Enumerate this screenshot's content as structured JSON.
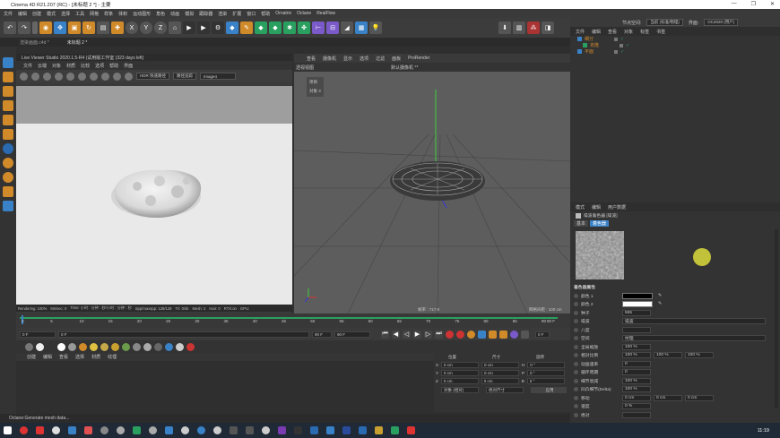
{
  "window": {
    "title": "Cinema 4D R21.207 (RC) - [未标题 2 *] - 主要",
    "controls": [
      "—",
      "❐",
      "✕"
    ]
  },
  "menubar": [
    "文件",
    "编辑",
    "创建",
    "模式",
    "选择",
    "工具",
    "网格",
    "样条",
    "体积",
    "运动图形",
    "角色",
    "动画",
    "模拟",
    "跟踪器",
    "渲染",
    "扩展",
    "窗口",
    "帮助",
    "Ornatrix",
    "Octane",
    "RealFlow"
  ],
  "doc_tabs": [
    "渲染画面.c4d *",
    "未标题 2 *"
  ],
  "live_viewer": {
    "header": "Live Viewer Studio 2020.1.5-R4 (试用版工作室 (323 days left)",
    "menu": [
      "文件",
      "云端",
      "对象",
      "材质",
      "比较",
      "选项",
      "帮助",
      "界面"
    ],
    "hdr_select": "HDR 快速路径",
    "mode_select": "路径追踪",
    "image_select": "Image4",
    "status": [
      "Rendering: 100%",
      "Ms/sec: 0",
      "Time: 小时 : 分钟 : 秒/小时 : 分钟 : 秒",
      "Spp/maxspp: 128/128",
      "Tri: 0/4k",
      "Mesh: 2",
      "Hair: 0",
      "RTX:on",
      "GPU:"
    ]
  },
  "viewport": {
    "menu": [
      "查看",
      "摄像机",
      "显示",
      "选项",
      "过滤",
      "面板",
      "ProRender"
    ],
    "label": "透视视图",
    "camera": "默认摄像机 °*",
    "hud": [
      "项目",
      "对象  3"
    ],
    "grid_info": "网格间距 : 100 cm",
    "frame_info": "帧率 : 717.9"
  },
  "timeline": {
    "ticks": [
      "0",
      "5",
      "10",
      "15",
      "20",
      "25",
      "30",
      "35",
      "40",
      "45",
      "50",
      "55",
      "60",
      "65",
      "70",
      "75",
      "80",
      "85",
      "90"
    ],
    "end_frame": "90 F",
    "current": "0 F",
    "start": "0 F",
    "field_start": "0 F",
    "field_end": "90 F",
    "field_end2": "90 F",
    "frame_right": "0 F"
  },
  "materials_menu": [
    "创建",
    "编辑",
    "查看",
    "选择",
    "材质",
    "纹理"
  ],
  "coords": {
    "headers": [
      "位置",
      "尺寸",
      "旋转"
    ],
    "rows": [
      {
        "axis": "X",
        "pos": "0 cm",
        "size": "0 cm",
        "rot_label": "H",
        "rot": "0 °"
      },
      {
        "axis": "Y",
        "pos": "0 cm",
        "size": "0 cm",
        "rot_label": "P",
        "rot": "0 °"
      },
      {
        "axis": "Z",
        "pos": "0 cm",
        "size": "0 cm",
        "rot_label": "B",
        "rot": "0 °"
      }
    ],
    "mode_select": "对象 (相对)",
    "size_select": "绝对尺寸",
    "apply": "应用"
  },
  "status_text": "Octane:Generate mesh data...",
  "right_panel": {
    "node_space_label": "节点空间:",
    "node_space": "当前 (标准/物理)",
    "layout_label": "界面:",
    "layout": "OC2020 (用户)",
    "obj_menu": [
      "文件",
      "编辑",
      "查看",
      "对象",
      "标签",
      "书签"
    ],
    "objects": [
      "细分",
      "克隆",
      "平面"
    ],
    "attr_menu": [
      "模式",
      "编辑",
      "用户数据"
    ],
    "shader_title": "噪波着色器 [噪波]",
    "tabs": [
      "基本",
      "着色器"
    ],
    "section": "着色器属性",
    "color1_label": "颜色 1",
    "color1": "#000000",
    "color2_label": "颜色 2",
    "color2": "#ffffff",
    "rows": [
      {
        "label": "种子",
        "values": [
          "665"
        ]
      },
      {
        "label": "噪波",
        "values": [
          "噪波"
        ]
      },
      {
        "label": "八度",
        "values": [
          ""
        ]
      },
      {
        "label": "空间",
        "values": [
          "纹理"
        ]
      },
      {
        "label": "全局缩放",
        "values": [
          "100 %"
        ]
      },
      {
        "label": "相对比例",
        "values": [
          "100 %",
          "100 %",
          "100 %"
        ]
      },
      {
        "label": "动画速率",
        "values": [
          "0"
        ]
      },
      {
        "label": "循环周期",
        "values": [
          "0"
        ]
      },
      {
        "label": "细节衰减",
        "values": [
          "100 %"
        ]
      },
      {
        "label": "凹凸细节(Delta)",
        "values": [
          "100 %"
        ]
      },
      {
        "label": "移动",
        "values": [
          "0 cm",
          "0 cm",
          "0 cm"
        ]
      },
      {
        "label": "速度",
        "values": [
          "0 %"
        ]
      },
      {
        "label": "绝对",
        "values": [
          ""
        ]
      }
    ]
  },
  "clock": "11:19"
}
